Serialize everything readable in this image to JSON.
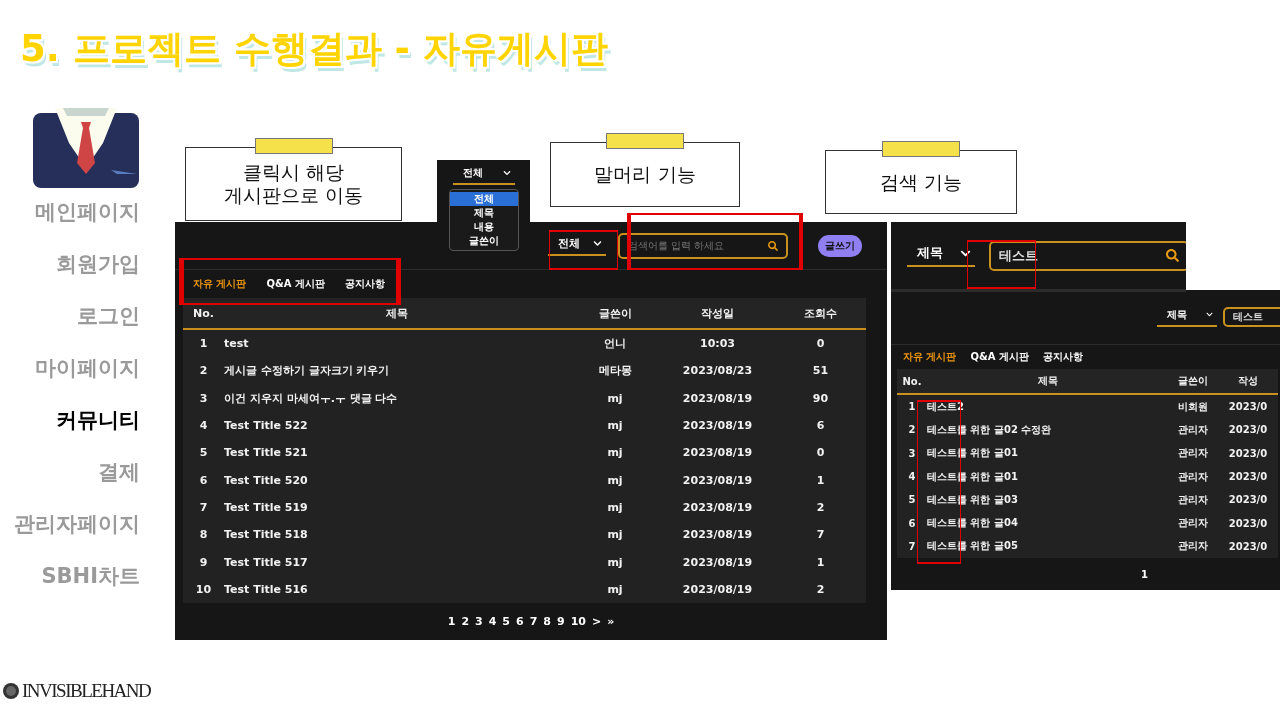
{
  "slide_title": "5. 프로젝트 수행결과 - 자유게시판",
  "sidebar": {
    "items": [
      {
        "label": "메인페이지",
        "selected": false
      },
      {
        "label": "회원가입",
        "selected": false
      },
      {
        "label": "로그인",
        "selected": false
      },
      {
        "label": "마이페이지",
        "selected": false
      },
      {
        "label": "커뮤니티",
        "selected": true
      },
      {
        "label": "결제",
        "selected": false
      },
      {
        "label": "관리자페이지",
        "selected": false
      },
      {
        "label": "SBHI차트",
        "selected": false
      }
    ]
  },
  "logo": "INVISIBLEHAND",
  "callouts": [
    {
      "lines": [
        "클릭시 해당",
        "게시판으로 이동"
      ]
    },
    {
      "lines": [
        "말머리 기능"
      ]
    },
    {
      "lines": [
        "검색 기능"
      ]
    }
  ],
  "board": {
    "filter": "전체",
    "search_placeholder": "검색어를 입력 하세요",
    "write_button": "글쓰기",
    "tabs": [
      {
        "label": "자유 게시판",
        "selected": true
      },
      {
        "label": "Q&A 게시판",
        "selected": false
      },
      {
        "label": "공지사항",
        "selected": false
      }
    ],
    "columns": [
      "No.",
      "제목",
      "글쓴이",
      "작성일",
      "조회수"
    ],
    "rows": [
      [
        "1",
        "test",
        "언니",
        "10:03",
        "0"
      ],
      [
        "2",
        "게시글 수정하기 글자크기 키우기",
        "메타몽",
        "2023/08/23",
        "51"
      ],
      [
        "3",
        "이건 지우지 마세여ㅜ.ㅜ 댓글 다수",
        "mj",
        "2023/08/19",
        "90"
      ],
      [
        "4",
        "Test Title 522",
        "mj",
        "2023/08/19",
        "6"
      ],
      [
        "5",
        "Test Title 521",
        "mj",
        "2023/08/19",
        "0"
      ],
      [
        "6",
        "Test Title 520",
        "mj",
        "2023/08/19",
        "1"
      ],
      [
        "7",
        "Test Title 519",
        "mj",
        "2023/08/19",
        "2"
      ],
      [
        "8",
        "Test Title 518",
        "mj",
        "2023/08/19",
        "7"
      ],
      [
        "9",
        "Test Title 517",
        "mj",
        "2023/08/19",
        "1"
      ],
      [
        "10",
        "Test Title 516",
        "mj",
        "2023/08/19",
        "2"
      ]
    ],
    "pagination": [
      "1",
      "2",
      "3",
      "4",
      "5",
      "6",
      "7",
      "8",
      "9",
      "10",
      ">",
      "»"
    ]
  },
  "filter_dropdown": {
    "value": "전체",
    "options": [
      {
        "label": "전체",
        "selected": true
      },
      {
        "label": "제목",
        "selected": false
      },
      {
        "label": "내용",
        "selected": false
      },
      {
        "label": "글쓴이",
        "selected": false
      }
    ]
  },
  "search_zoom": {
    "filter": "제목",
    "value": "테스트"
  },
  "search_result": {
    "filter": "제목",
    "value": "테스트",
    "tabs": [
      {
        "label": "자유 게시판",
        "selected": true
      },
      {
        "label": "Q&A 게시판",
        "selected": false
      },
      {
        "label": "공지사항",
        "selected": false
      }
    ],
    "columns": [
      "No.",
      "제목",
      "글쓴이",
      "작성"
    ],
    "rows": [
      [
        "1",
        "테스트2",
        "비회원",
        "2023/0"
      ],
      [
        "2",
        "테스트를 위한 글02 수정완",
        "관리자",
        "2023/0"
      ],
      [
        "3",
        "테스트를 위한 글01",
        "관리자",
        "2023/0"
      ],
      [
        "4",
        "테스트를 위한 글01",
        "관리자",
        "2023/0"
      ],
      [
        "5",
        "테스트를 위한 글03",
        "관리자",
        "2023/0"
      ],
      [
        "6",
        "테스트를 위한 글04",
        "관리자",
        "2023/0"
      ],
      [
        "7",
        "테스트를 위한 글05",
        "관리자",
        "2023/0"
      ]
    ],
    "pagination": [
      "1"
    ]
  }
}
